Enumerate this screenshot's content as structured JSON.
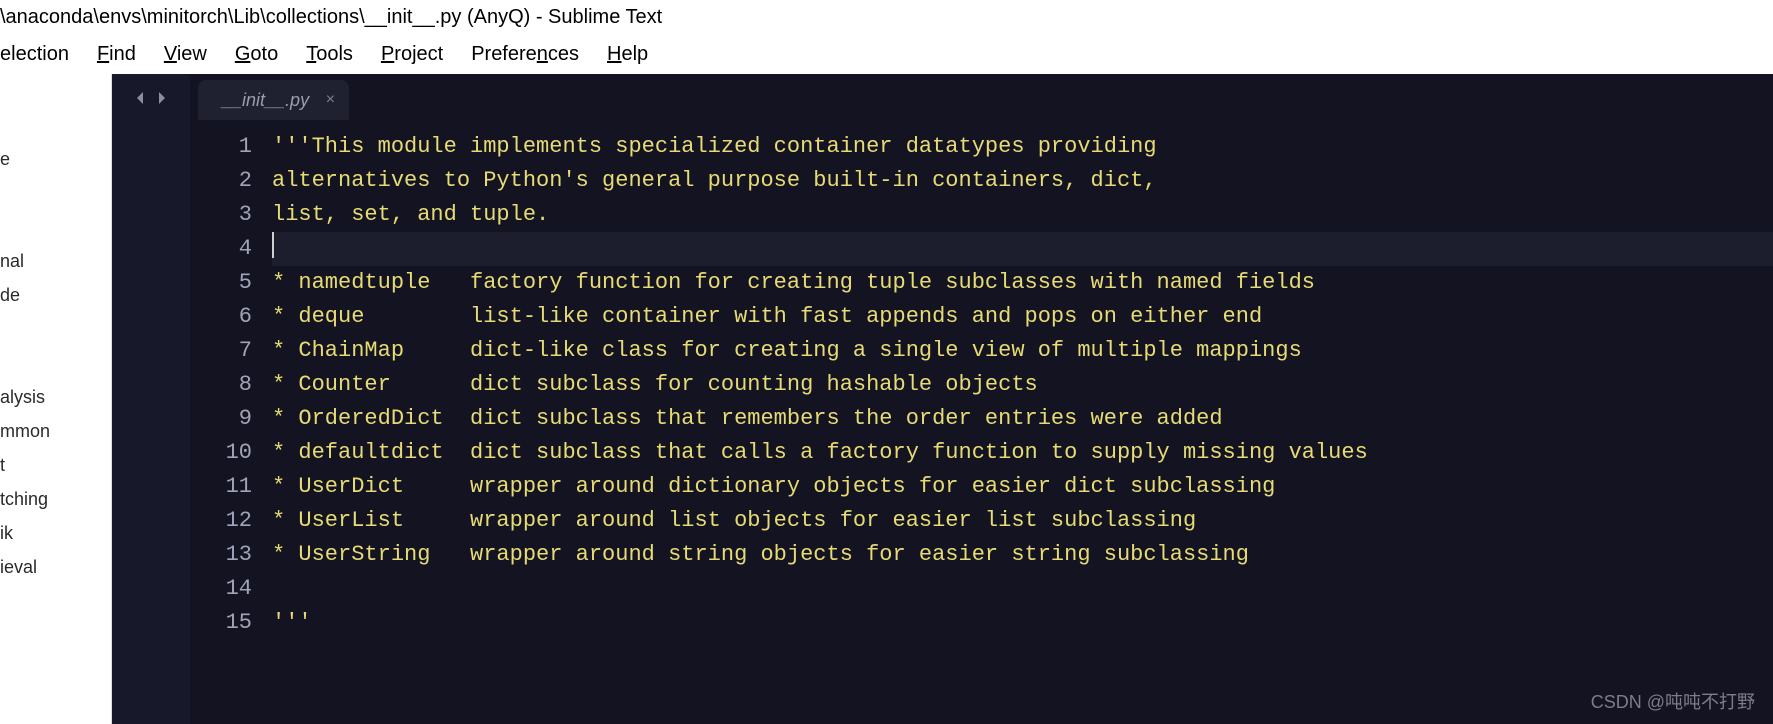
{
  "title": "\\anaconda\\envs\\minitorch\\Lib\\collections\\__init__.py (AnyQ) - Sublime Text",
  "menu": {
    "selection": "election",
    "find": "Find",
    "view": "View",
    "goto": "Goto",
    "tools": "Tools",
    "project": "Project",
    "preferences": "Preferences",
    "help": "Help"
  },
  "sidebar": [
    "",
    "",
    "e",
    "",
    "",
    "nal",
    "de",
    "",
    "",
    "alysis",
    "mmon",
    "t",
    "tching",
    "ik",
    "ieval"
  ],
  "tab": {
    "name": "__init__.py"
  },
  "lines": [
    "'''This module implements specialized container datatypes providing",
    "alternatives to Python's general purpose built-in containers, dict,",
    "list, set, and tuple.",
    "",
    "* namedtuple   factory function for creating tuple subclasses with named fields",
    "* deque        list-like container with fast appends and pops on either end",
    "* ChainMap     dict-like class for creating a single view of multiple mappings",
    "* Counter      dict subclass for counting hashable objects",
    "* OrderedDict  dict subclass that remembers the order entries were added",
    "* defaultdict  dict subclass that calls a factory function to supply missing values",
    "* UserDict     wrapper around dictionary objects for easier dict subclassing",
    "* UserList     wrapper around list objects for easier list subclassing",
    "* UserString   wrapper around string objects for easier string subclassing",
    "",
    "'''"
  ],
  "current_line": 4,
  "line_numbers": [
    "1",
    "2",
    "3",
    "4",
    "5",
    "6",
    "7",
    "8",
    "9",
    "10",
    "11",
    "12",
    "13",
    "14",
    "15"
  ],
  "watermark": "CSDN @吨吨不打野"
}
